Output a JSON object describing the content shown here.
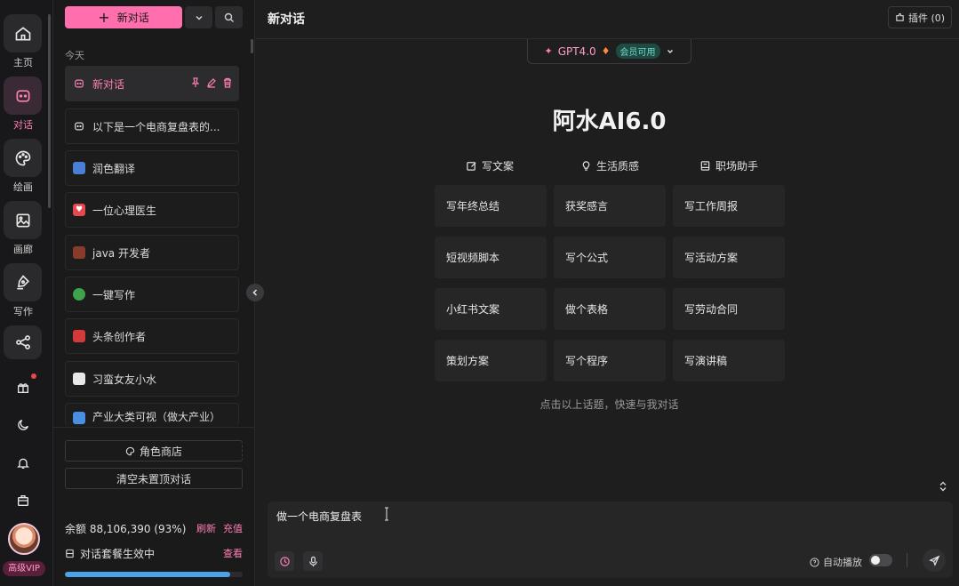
{
  "rail": {
    "items": [
      {
        "label": "主页",
        "icon": "home-icon"
      },
      {
        "label": "对话",
        "icon": "chat-icon"
      },
      {
        "label": "绘画",
        "icon": "palette-icon"
      },
      {
        "label": "画廊",
        "icon": "image-icon"
      },
      {
        "label": "写作",
        "icon": "pen-icon"
      },
      {
        "label": "",
        "icon": "share-icon"
      }
    ],
    "small_icons": [
      "gift-icon",
      "moon-icon",
      "bell-icon",
      "briefcase-icon"
    ],
    "vip_label": "高级VIP"
  },
  "sidebar": {
    "new_chat_label": "新对话",
    "today_label": "今天",
    "conversations": [
      {
        "title": "新对话",
        "icon": "chat-icon"
      },
      {
        "title": "以下是一个电商复盘表的...",
        "icon": "chat-icon"
      },
      {
        "title": "润色翻译",
        "icon": "translate-icon"
      },
      {
        "title": "一位心理医生",
        "icon": "heart-icon"
      },
      {
        "title": "java 开发者",
        "icon": "code-icon"
      },
      {
        "title": "一键写作",
        "icon": "write-icon"
      },
      {
        "title": "头条创作者",
        "icon": "news-icon"
      },
      {
        "title": "习蛮女友小水",
        "icon": "girl-icon"
      },
      {
        "title": "产业大类可视（做大产业）",
        "icon": "folder-icon"
      }
    ],
    "role_store_label": "角色商店",
    "clear_label": "清空未置顶对话",
    "balance_text": "余额 88,106,390 (93%)",
    "balance_percent": 93,
    "refresh_label": "刷新",
    "recharge_label": "充值",
    "plan_text": "对话套餐生效中",
    "plan_link": "查看"
  },
  "header": {
    "title": "新对话",
    "plugin_label": "插件 (0)"
  },
  "model": {
    "name": "GPT4.0",
    "badge": "会员可用"
  },
  "hero": {
    "title": "阿水AI6.0",
    "categories": [
      {
        "label": "写文案",
        "icon": "edit-icon"
      },
      {
        "label": "生活质感",
        "icon": "bulb-icon"
      },
      {
        "label": "职场助手",
        "icon": "briefcase-icon"
      }
    ],
    "topics": [
      "写年终总结",
      "获奖感言",
      "写工作周报",
      "短视频脚本",
      "写个公式",
      "写活动方案",
      "小红书文案",
      "做个表格",
      "写劳动合同",
      "策划方案",
      "写个程序",
      "写演讲稿"
    ],
    "hint": "点击以上话题，快速与我对话"
  },
  "input": {
    "value": "做一个电商复盘表",
    "autoplay_label": "自动播放",
    "autoplay_on": false
  },
  "colors": {
    "accent": "#ff6fae",
    "background": "#1e1e1f",
    "progress": "#4aa3e8"
  }
}
